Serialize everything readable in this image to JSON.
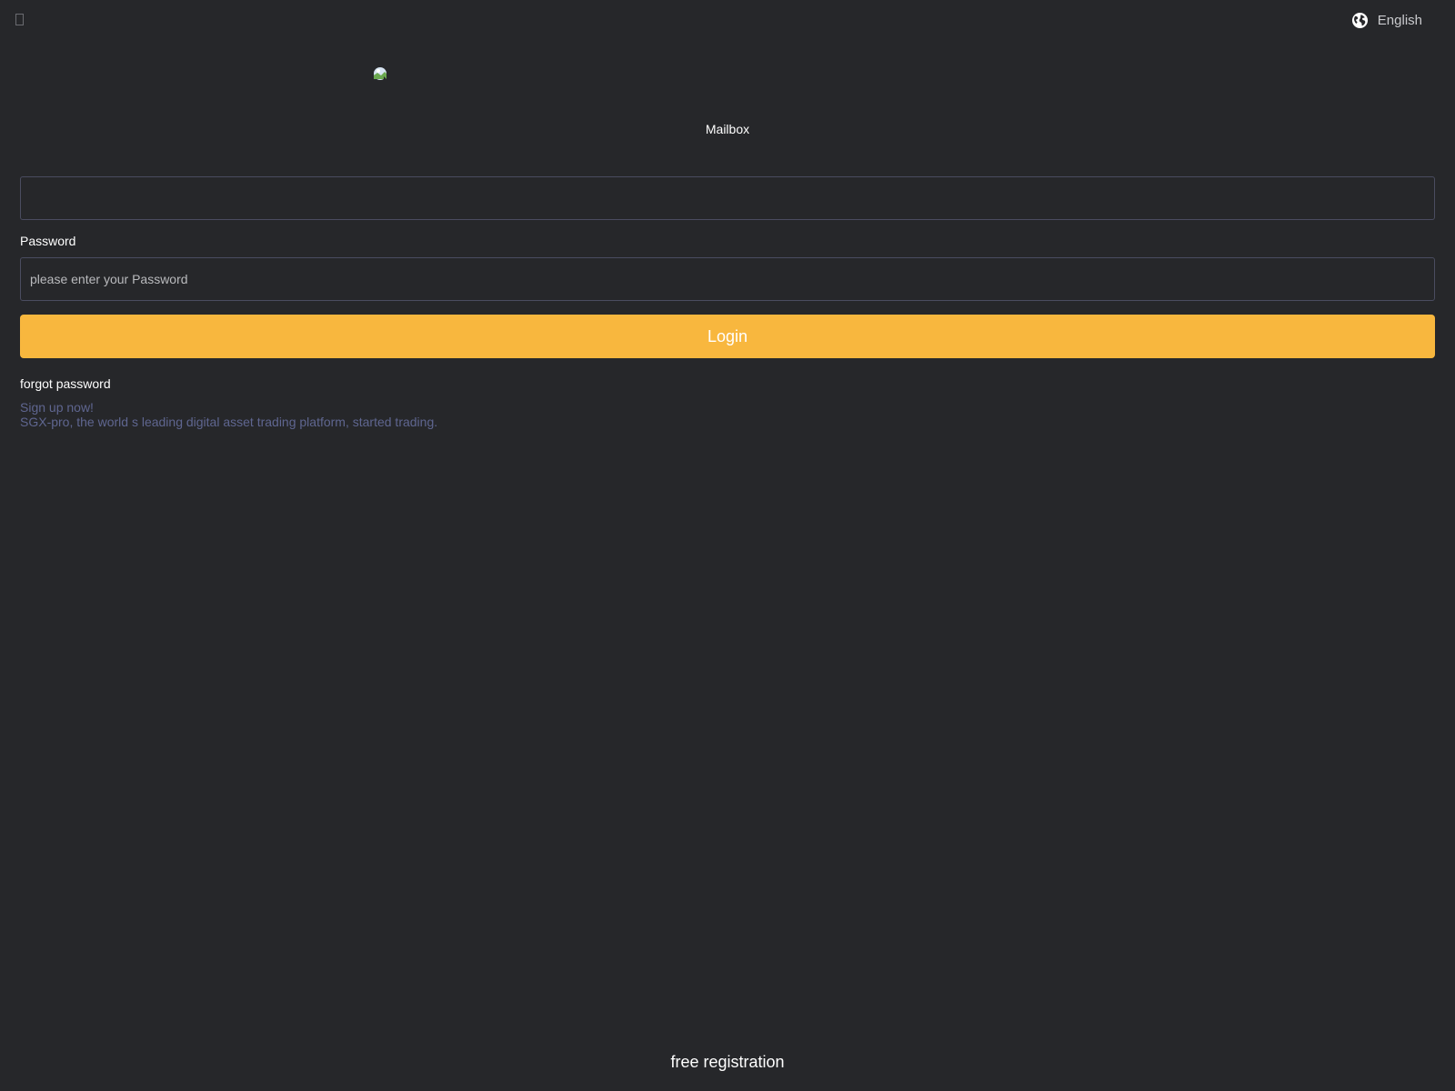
{
  "header": {
    "language_label": "English",
    "globe_icon": "globe-icon",
    "back_icon": "missing-glyph-icon"
  },
  "login": {
    "mailbox_label": "Mailbox",
    "mailbox_value": "",
    "password_label": "Password",
    "password_placeholder": "please enter your Password",
    "login_button": "Login",
    "forgot_password": "forgot password",
    "signup_now": "Sign up now!",
    "signup_tagline": "SGX-pro, the world s leading digital asset trading platform, started trading."
  },
  "footer": {
    "free_registration": "free registration"
  },
  "colors": {
    "background": "#26272a",
    "accent": "#f8b73e",
    "muted_link": "#5f6690",
    "input_border": "#4a4c60"
  }
}
